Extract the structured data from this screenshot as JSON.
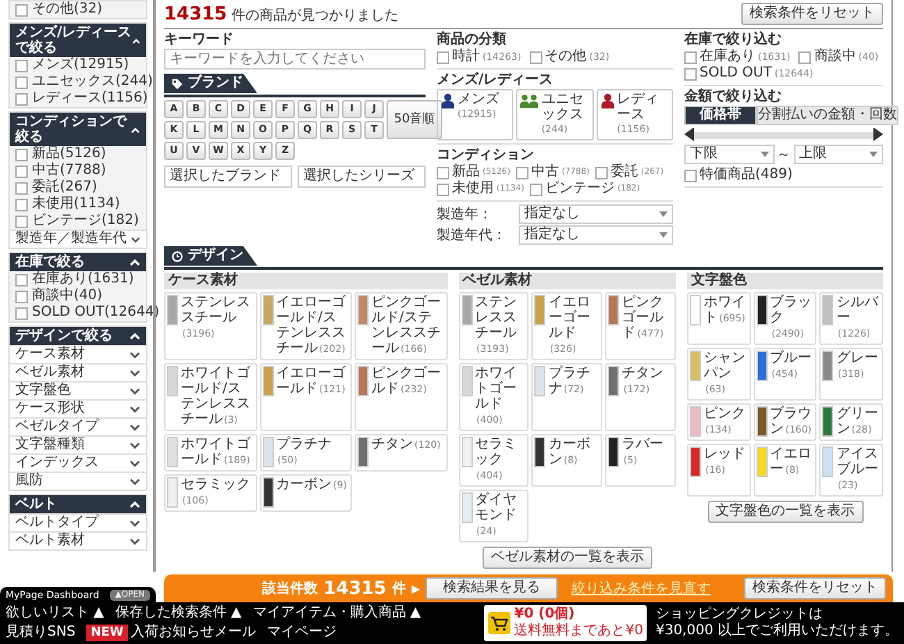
{
  "sidebar": {
    "sections": [
      {
        "items": [
          {
            "kind": "checkbox",
            "label": "その他(32)",
            "checked": false
          }
        ]
      },
      {
        "title": "メンズ/レディースで絞る",
        "expanded": true,
        "items": [
          {
            "kind": "checkbox",
            "label": "メンズ(12915)",
            "checked": false
          },
          {
            "kind": "checkbox",
            "label": "ユニセックス(244)",
            "checked": false
          },
          {
            "kind": "checkbox",
            "label": "レディース(1156)",
            "checked": false
          }
        ]
      },
      {
        "title": "コンディションで絞る",
        "expanded": true,
        "items": [
          {
            "kind": "checkbox",
            "label": "新品(5126)",
            "checked": false
          },
          {
            "kind": "checkbox",
            "label": "中古(7788)",
            "checked": false
          },
          {
            "kind": "checkbox",
            "label": "委託(267)",
            "checked": false
          },
          {
            "kind": "checkbox",
            "label": "未使用(1134)",
            "checked": false
          },
          {
            "kind": "checkbox",
            "label": "ビンテージ(182)",
            "checked": false
          },
          {
            "kind": "dropdown",
            "label": "製造年／製造年代"
          }
        ]
      },
      {
        "title": "在庫で絞る",
        "expanded": true,
        "items": [
          {
            "kind": "checkbox",
            "label": "在庫あり(1631)",
            "checked": false
          },
          {
            "kind": "checkbox",
            "label": "商談中(40)",
            "checked": false
          },
          {
            "kind": "checkbox",
            "label": "SOLD OUT(12644)",
            "checked": false
          }
        ]
      },
      {
        "title": "デザインで絞る",
        "expanded": true,
        "items": [
          {
            "kind": "dropdown",
            "label": "ケース素材"
          },
          {
            "kind": "dropdown",
            "label": "ベゼル素材"
          },
          {
            "kind": "dropdown",
            "label": "文字盤色"
          },
          {
            "kind": "dropdown",
            "label": "ケース形状"
          },
          {
            "kind": "dropdown",
            "label": "ベゼルタイプ"
          },
          {
            "kind": "dropdown",
            "label": "文字盤種類"
          },
          {
            "kind": "dropdown",
            "label": "インデックス"
          },
          {
            "kind": "dropdown",
            "label": "風防"
          }
        ]
      },
      {
        "title": "ベルト",
        "expanded": true,
        "items": [
          {
            "kind": "dropdown",
            "label": "ベルトタイプ"
          },
          {
            "kind": "dropdown",
            "label": "ベルト素材"
          }
        ]
      }
    ]
  },
  "results": {
    "count": "14315",
    "text": "件の商品が見つかりました",
    "reset_button": "検索条件をリセット"
  },
  "keyword": {
    "label": "キーワード",
    "placeholder": "キーワードを入力してください"
  },
  "brand": {
    "tab": "ブランド",
    "letters": [
      "A",
      "B",
      "C",
      "D",
      "E",
      "F",
      "G",
      "H",
      "I",
      "J",
      "K",
      "L",
      "M",
      "N",
      "O",
      "P",
      "Q",
      "R",
      "S",
      "T",
      "U",
      "V",
      "W",
      "X",
      "Y",
      "Z"
    ],
    "kana_button": "50音順",
    "selected_brand": "選択したブランド",
    "selected_series": "選択したシリーズ"
  },
  "category": {
    "title": "商品の分類",
    "options": [
      {
        "label": "時計",
        "count": "(14263)",
        "checked": false
      },
      {
        "label": "その他",
        "count": "(32)",
        "checked": false
      }
    ]
  },
  "gender": {
    "title": "メンズ/レディース",
    "options": [
      {
        "label": "メンズ",
        "count": "(12915)",
        "kind": "single",
        "color": "#1f3a80"
      },
      {
        "label": "ユニセックス",
        "count": "(244)",
        "kind": "pair",
        "color": "#4a8a2a"
      },
      {
        "label": "レディース",
        "count": "(1156)",
        "kind": "single",
        "color": "#b0182a"
      }
    ]
  },
  "condition": {
    "title": "コンディション",
    "options": [
      {
        "label": "新品",
        "count": "(5126)",
        "checked": false
      },
      {
        "label": "中古",
        "count": "(7788)",
        "checked": false
      },
      {
        "label": "委託",
        "count": "(267)",
        "checked": false
      },
      {
        "label": "未使用",
        "count": "(1134)",
        "checked": false
      },
      {
        "label": "ビンテージ",
        "count": "(182)",
        "checked": false
      }
    ]
  },
  "year": [
    {
      "label": "製造年：",
      "value": "指定なし"
    },
    {
      "label": "製造年代：",
      "value": "指定なし"
    }
  ],
  "stock": {
    "title": "在庫で絞り込む",
    "options": [
      {
        "label": "在庫あり",
        "count": "(1631)",
        "checked": false
      },
      {
        "label": "商談中",
        "count": "(40)",
        "checked": false
      },
      {
        "label": "SOLD OUT",
        "count": "(12644)",
        "checked": false
      }
    ]
  },
  "price": {
    "title": "金額で絞り込む",
    "tabs": [
      {
        "label": "価格帯",
        "selected": true
      },
      {
        "label": "分割払いの金額・回数",
        "selected": false
      }
    ],
    "slider": {
      "handles": [
        {
          "level": 0
        },
        {
          "level": 1
        }
      ]
    },
    "min": "下限",
    "separator": "～",
    "max": "上限",
    "special": {
      "label": "特価商品(489)",
      "checked": false
    }
  },
  "design": {
    "tab": "デザイン",
    "groups": [
      {
        "title": "ケース素材",
        "items": [
          {
            "name": "ステンレススチール",
            "count": "(3196)",
            "color": "#a8a8a8"
          },
          {
            "name": "イエローゴールド/ステンレススチール",
            "count": "(202)",
            "color": "#c8a860"
          },
          {
            "name": "ピンクゴールド/ステンレススチール",
            "count": "(166)",
            "color": "#c08868"
          },
          {
            "name": "ホワイトゴールド/ステンレススチール",
            "count": "(3)",
            "color": "#d8d8d8"
          },
          {
            "name": "イエローゴールド",
            "count": "(121)",
            "color": "#c9a24a"
          },
          {
            "name": "ピンクゴールド",
            "count": "(232)",
            "color": "#b87858"
          },
          {
            "name": "ホワイトゴールド",
            "count": "(189)",
            "color": "#e0e0e0"
          },
          {
            "name": "プラチナ",
            "count": "(50)",
            "color": "#dde4e8"
          },
          {
            "name": "チタン",
            "count": "(120)",
            "color": "#707070"
          },
          {
            "name": "セラミック",
            "count": "(106)",
            "color": "#f0f0f0"
          },
          {
            "name": "カーボン",
            "count": "(9)",
            "color": "#333333"
          }
        ]
      },
      {
        "title": "ベゼル素材",
        "button": "ベゼル素材の一覧を表示",
        "items": [
          {
            "name": "ステンレススチール",
            "count": "(3193)",
            "color": "#a8a8a8"
          },
          {
            "name": "イエローゴールド",
            "count": "(326)",
            "color": "#c9a24a"
          },
          {
            "name": "ピンクゴールド",
            "count": "(477)",
            "color": "#b87858"
          },
          {
            "name": "ホワイトゴールド",
            "count": "(400)",
            "color": "#d8d8d8"
          },
          {
            "name": "プラチナ",
            "count": "(72)",
            "color": "#dde4e8"
          },
          {
            "name": "チタン",
            "count": "(172)",
            "color": "#707070"
          },
          {
            "name": "セラミック",
            "count": "(404)",
            "color": "#f0f0f0"
          },
          {
            "name": "カーボン",
            "count": "(8)",
            "color": "#333333"
          },
          {
            "name": "ラバー",
            "count": "(5)",
            "color": "#222222"
          },
          {
            "name": "ダイヤモンド",
            "count": "(24)",
            "color": "#e8eef2"
          }
        ]
      },
      {
        "title": "文字盤色",
        "button": "文字盤色の一覧を表示",
        "items": [
          {
            "name": "ホワイト",
            "count": "(695)",
            "color": "#ffffff"
          },
          {
            "name": "ブラック",
            "count": "(2490)",
            "color": "#222222"
          },
          {
            "name": "シルバー",
            "count": "(1226)",
            "color": "#c0c0c0"
          },
          {
            "name": "シャンパン",
            "count": "(63)",
            "color": "#d8c060"
          },
          {
            "name": "ブルー",
            "count": "(454)",
            "color": "#2a6fd8"
          },
          {
            "name": "グレー",
            "count": "(318)",
            "color": "#8a8a8a"
          },
          {
            "name": "ピンク",
            "count": "(134)",
            "color": "#f0b8c0"
          },
          {
            "name": "ブラウン",
            "count": "(160)",
            "color": "#7a5a2a"
          },
          {
            "name": "グリーン",
            "count": "(28)",
            "color": "#2a7a3a"
          },
          {
            "name": "レッド",
            "count": "(16)",
            "color": "#d8282a"
          },
          {
            "name": "イエロー",
            "count": "(8)",
            "color": "#f8d820"
          },
          {
            "name": "アイスブルー",
            "count": "(23)",
            "color": "#c8e4f4"
          }
        ]
      }
    ]
  },
  "search_bar": {
    "label": "該当件数",
    "count": "14315",
    "unit": "件",
    "arrow": "▶",
    "view_button": "検索結果を見る",
    "review_link": "絞り込み条件を見直す",
    "reset_button": "検索条件をリセット"
  },
  "dashboard": {
    "tab": "MyPage Dashboard",
    "toggle": "▲OPEN",
    "links": [
      {
        "label": "欲しいリスト",
        "arrow": "▲"
      },
      {
        "label": "保存した検索条件",
        "arrow": "▲"
      },
      {
        "label": "マイアイテム・購入商品",
        "arrow": "▲"
      },
      {
        "label": "見積りSNS"
      },
      {
        "label": "入荷お知らせメール",
        "badge": "NEW"
      },
      {
        "label": "マイページ"
      }
    ],
    "cart": {
      "amount": "¥0 (0個)",
      "note": "送料無料まであと¥0"
    },
    "credit": [
      "ショッピングクレジットは",
      "¥30,000 以上でご利用いただけます。"
    ]
  }
}
